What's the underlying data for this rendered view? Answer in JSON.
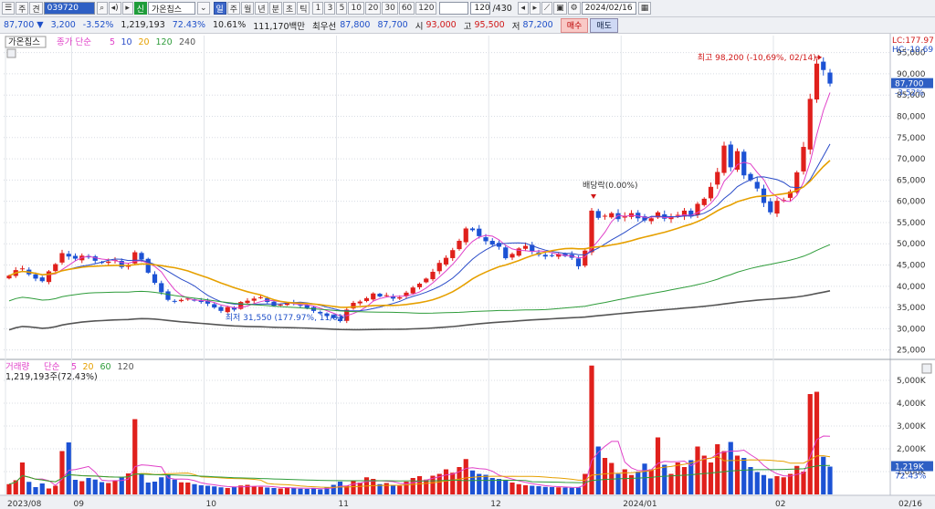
{
  "toolbar": {
    "btn_a": "주",
    "btn_b": "견",
    "code": "039720",
    "btn_sin": "신",
    "stock_name": "가온칩스",
    "periods": [
      "일",
      "주",
      "월",
      "년",
      "분",
      "초",
      "틱"
    ],
    "numbers": [
      "1",
      "3",
      "5",
      "10",
      "20",
      "30",
      "60",
      "120"
    ],
    "count": "120",
    "total": "/430",
    "date": "2024/02/16"
  },
  "quote": {
    "price": "87,700",
    "arrow": "▼",
    "change": "3,200",
    "change_pct": "-3.52%",
    "volume": "1,219,193",
    "volume_ratio": "72.43%",
    "turnover": "10.61%",
    "amount": "111,170백만",
    "best_label": "최우선",
    "bid": "87,800",
    "ask": "87,700",
    "open_label": "시",
    "open": "93,000",
    "high_label": "고",
    "high": "95,500",
    "low_label": "저",
    "low": "87,200",
    "buy": "매수",
    "sell": "매도"
  },
  "colors": {
    "up": "#e0201c",
    "down": "#1c52d4",
    "ma5": "#e040c8",
    "ma10": "#2a4cc8",
    "ma20": "#e6a000",
    "ma60": "#2e9c3a",
    "ma120": "#555555"
  },
  "chart_data": {
    "type": "candlestick",
    "legend_price": {
      "name": "가온칩스",
      "label": "종가 단순",
      "periods": [
        "5",
        "10",
        "20",
        "120",
        "240"
      ]
    },
    "legend_volume": {
      "name": "거래량",
      "label": "단순",
      "periods": [
        "5",
        "20",
        "60",
        "120"
      ],
      "value": "1,219,193주(72.43%)"
    },
    "lc": "LC:177.97",
    "hc": "HC:-10.69",
    "high_annotation": "최고 98,200 (-10,69%, 02/14)",
    "low_annotation": "최저 31,550 (177.97%, 11/01)",
    "dividend_annotation": "배당락(0.00%)",
    "price_axis": [
      "95,000",
      "90,000",
      "85,000",
      "80,000",
      "75,000",
      "70,000",
      "65,000",
      "60,000",
      "55,000",
      "50,000",
      "45,000",
      "40,000",
      "35,000",
      "30,000",
      "25,000"
    ],
    "price_range": [
      23000,
      99000
    ],
    "current_price_label": "87,700",
    "current_change_label": "-3.52%",
    "volume_axis": [
      "5,000K",
      "4,000K",
      "3,000K",
      "2,000K",
      "1,000K"
    ],
    "volume_range": [
      0,
      5800
    ],
    "current_volume_label": "1,219K",
    "current_volume_pct": "72.43%",
    "x_labels": [
      {
        "label": "2023/08",
        "index": 0
      },
      {
        "label": "09",
        "index": 10
      },
      {
        "label": "10",
        "index": 30
      },
      {
        "label": "11",
        "index": 50
      },
      {
        "label": "12",
        "index": 73
      },
      {
        "label": "2024/01",
        "index": 93
      },
      {
        "label": "02",
        "index": 116
      }
    ],
    "right_date": "02/16",
    "close": [
      42500,
      43800,
      44200,
      42800,
      41800,
      41200,
      43500,
      45200,
      47800,
      47000,
      46500,
      47200,
      46800,
      46000,
      45500,
      45800,
      46200,
      44500,
      45000,
      48000,
      46300,
      43200,
      40800,
      38600,
      36800,
      36500,
      36800,
      37100,
      36600,
      36300,
      35900,
      35000,
      34200,
      35100,
      34500,
      36300,
      36600,
      37100,
      37400,
      36300,
      35400,
      35700,
      36100,
      35900,
      35600,
      34900,
      34200,
      33600,
      33000,
      32500,
      31800,
      34500,
      36100,
      36400,
      37200,
      38300,
      37600,
      37900,
      37100,
      37400,
      38500,
      39700,
      40600,
      41800,
      43400,
      45500,
      46700,
      48500,
      50700,
      53600,
      53200,
      51800,
      50600,
      49800,
      49300,
      46600,
      47600,
      48900,
      49500,
      48300,
      47400,
      47000,
      47200,
      47600,
      47100,
      46700,
      44700,
      48400,
      57800,
      56100,
      56600,
      57200,
      55800,
      56600,
      57200,
      56000,
      55500,
      56000,
      57400,
      55900,
      56300,
      56800,
      57800,
      56400,
      59400,
      60600,
      63400,
      66900,
      73100,
      68000,
      71800,
      66100,
      65000,
      63000,
      59600,
      57400,
      60100,
      60300,
      62300,
      66800,
      72800,
      84100,
      92400,
      90900,
      87700
    ],
    "volume": [
      450,
      620,
      1400,
      550,
      320,
      480,
      260,
      380,
      1900,
      2280,
      640,
      580,
      720,
      650,
      540,
      500,
      620,
      750,
      920,
      3300,
      900,
      520,
      560,
      750,
      880,
      650,
      530,
      520,
      450,
      400,
      380,
      350,
      310,
      280,
      330,
      390,
      420,
      350,
      330,
      300,
      280,
      260,
      310,
      280,
      250,
      240,
      270,
      220,
      300,
      420,
      560,
      380,
      600,
      520,
      750,
      680,
      450,
      500,
      420,
      380,
      560,
      720,
      800,
      650,
      820,
      900,
      1100,
      950,
      1200,
      1550,
      1050,
      900,
      860,
      720,
      680,
      600,
      520,
      450,
      400,
      380,
      360,
      330,
      320,
      310,
      300,
      290,
      300,
      900,
      5650,
      2100,
      1600,
      1380,
      900,
      1100,
      850,
      1000,
      1350,
      1100,
      2500,
      1300,
      900,
      1400,
      1200,
      1500,
      2100,
      1700,
      1400,
      2200,
      1900,
      2300,
      1700,
      1600,
      1200,
      980,
      850,
      700,
      800,
      750,
      900,
      1250,
      1000,
      4400,
      4500,
      1650,
      1219
    ],
    "last_volume_value": 1219193
  }
}
